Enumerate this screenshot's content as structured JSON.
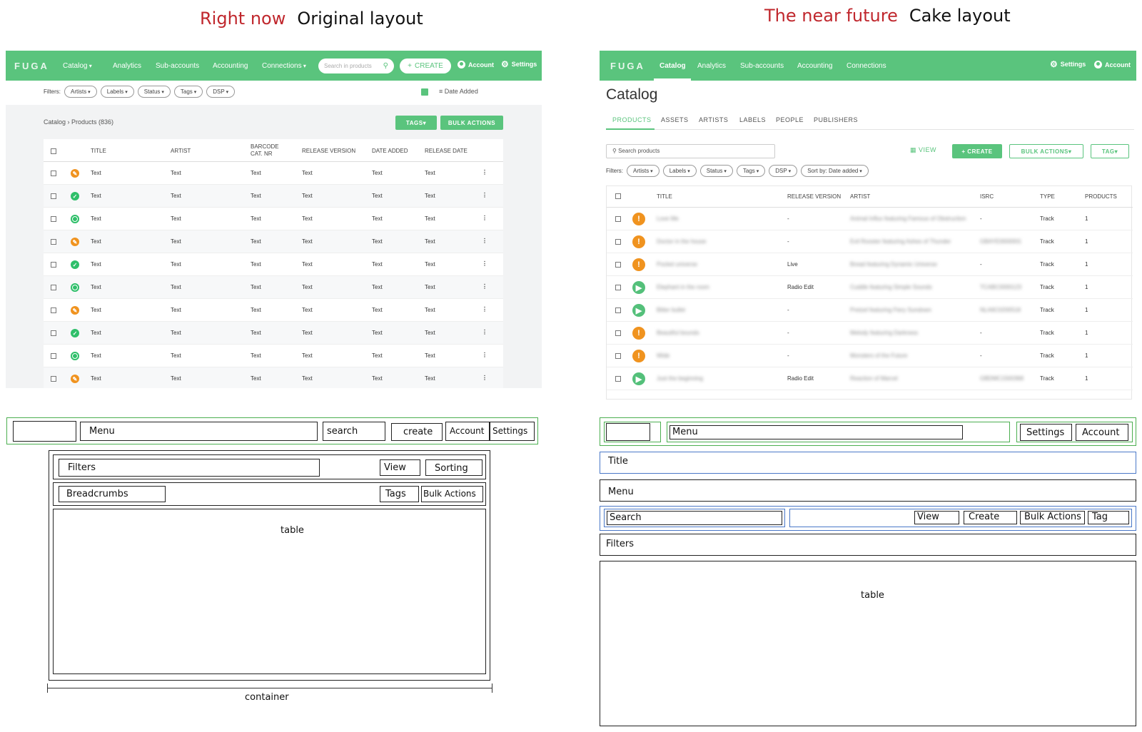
{
  "left": {
    "heading": {
      "red": "Right now",
      "black": "Original layout"
    },
    "nav": {
      "logo": "FUGA",
      "items": [
        "Catalog",
        "Analytics",
        "Sub-accounts",
        "Accounting",
        "Connections"
      ],
      "search_placeholder": "Search in products",
      "create": "CREATE",
      "account": "Account",
      "settings": "Settings"
    },
    "filters_label": "Filters:",
    "filters": [
      "Artists",
      "Labels",
      "Status",
      "Tags",
      "DSP"
    ],
    "sort": "Date Added",
    "breadcrumb": {
      "root": "Catalog",
      "current": "Products (836)"
    },
    "tags_button": "TAGS",
    "bulk_button": "BULK ACTIONS",
    "columns": [
      "TITLE",
      "ARTIST",
      "BARCODE\nCAT. NR",
      "RELEASE VERSION",
      "DATE ADDED",
      "RELEASE DATE"
    ],
    "cell_text": "Text",
    "row_status": [
      "orange",
      "green",
      "green-ring",
      "orange",
      "green",
      "green-ring",
      "orange",
      "green",
      "green-ring",
      "orange"
    ]
  },
  "right": {
    "heading": {
      "red": "The near future",
      "black": "Cake layout"
    },
    "nav": {
      "logo": "FUGA",
      "items": [
        "Catalog",
        "Analytics",
        "Sub-accounts",
        "Accounting",
        "Connections"
      ],
      "settings": "Settings",
      "account": "Account"
    },
    "title": "Catalog",
    "tabs": [
      "PRODUCTS",
      "ASSETS",
      "ARTISTS",
      "LABELS",
      "PEOPLE",
      "PUBLISHERS"
    ],
    "search_placeholder": "Search products",
    "view": "VIEW",
    "create": "CREATE",
    "bulk": "BULK ACTIONS",
    "tag": "TAG",
    "filters_label": "Filters:",
    "filters": [
      "Artists",
      "Labels",
      "Status",
      "Tags",
      "DSP",
      "Sort by: Date added"
    ],
    "columns": [
      "TITLE",
      "RELEASE VERSION",
      "ARTIST",
      "ISRC",
      "TYPE",
      "PRODUCTS"
    ],
    "rows": [
      {
        "status": "warning",
        "title": "Love Me",
        "version": "-",
        "artist": "Animal Influx featuring Famous of Obstruction",
        "isrc": "-",
        "type": "Track",
        "products": "1"
      },
      {
        "status": "warning",
        "title": "Doctor in the house",
        "version": "-",
        "artist": "Evil Rooster featuring Ashes of Thunder",
        "isrc": "GBAYE0000001",
        "type": "Track",
        "products": "1"
      },
      {
        "status": "warning",
        "title": "Pocket universe",
        "version": "Live",
        "artist": "Bread featuring Dynamic Universe",
        "isrc": "-",
        "type": "Track",
        "products": "1"
      },
      {
        "status": "play",
        "title": "Elephant in the room",
        "version": "Radio Edit",
        "artist": "Cuddle featuring Simple Sounds",
        "isrc": "TCABC0000123",
        "type": "Track",
        "products": "1"
      },
      {
        "status": "play",
        "title": "Bitter bullet",
        "version": "-",
        "artist": "Pretzel featuring Fiery Sundown",
        "isrc": "NLA6C0200518",
        "type": "Track",
        "products": "1"
      },
      {
        "status": "warning",
        "title": "Beautiful bounds",
        "version": "-",
        "artist": "Melody featuring Darkness",
        "isrc": "-",
        "type": "Track",
        "products": "1"
      },
      {
        "status": "warning",
        "title": "Wide",
        "version": "-",
        "artist": "Monsters of the Future",
        "isrc": "-",
        "type": "Track",
        "products": "1"
      },
      {
        "status": "play",
        "title": "Just the beginning",
        "version": "Radio Edit",
        "artist": "Reaction of Marcel",
        "isrc": "GBDMC1500368",
        "type": "Track",
        "products": "1"
      }
    ]
  },
  "wire_left": {
    "menu": "Menu",
    "search": "search",
    "create": "create",
    "account": "Account",
    "settings": "Settings",
    "filters": "Filters",
    "view": "View",
    "sorting": "Sorting",
    "breadcrumbs": "Breadcrumbs",
    "tags": "Tags",
    "bulk": "Bulk Actions",
    "table": "table",
    "container": "container"
  },
  "wire_right": {
    "menu": "Menu",
    "settings": "Settings",
    "account": "Account",
    "title": "Title",
    "menu2": "Menu",
    "search": "Search",
    "view": "View",
    "create": "Create",
    "bulk": "Bulk Actions",
    "tag": "Tag",
    "filters": "Filters",
    "table": "table"
  },
  "colors": {
    "green": "#5ac47d",
    "red_heading": "#c0272d",
    "orange": "#f0931f",
    "wire_blue": "#4a78c8"
  }
}
